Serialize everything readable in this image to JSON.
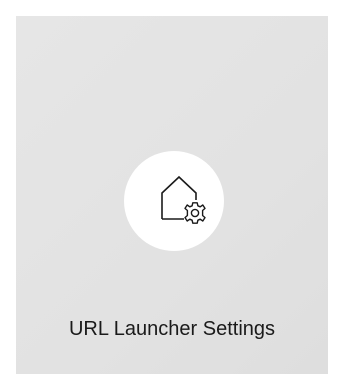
{
  "tile": {
    "label": "URL Launcher Settings",
    "icon": "home-gear-icon"
  },
  "colors": {
    "tile_background": "#e3e3e3",
    "icon_circle": "#ffffff",
    "icon_stroke": "#1a1a1a",
    "label_text": "#1a1a1a"
  }
}
